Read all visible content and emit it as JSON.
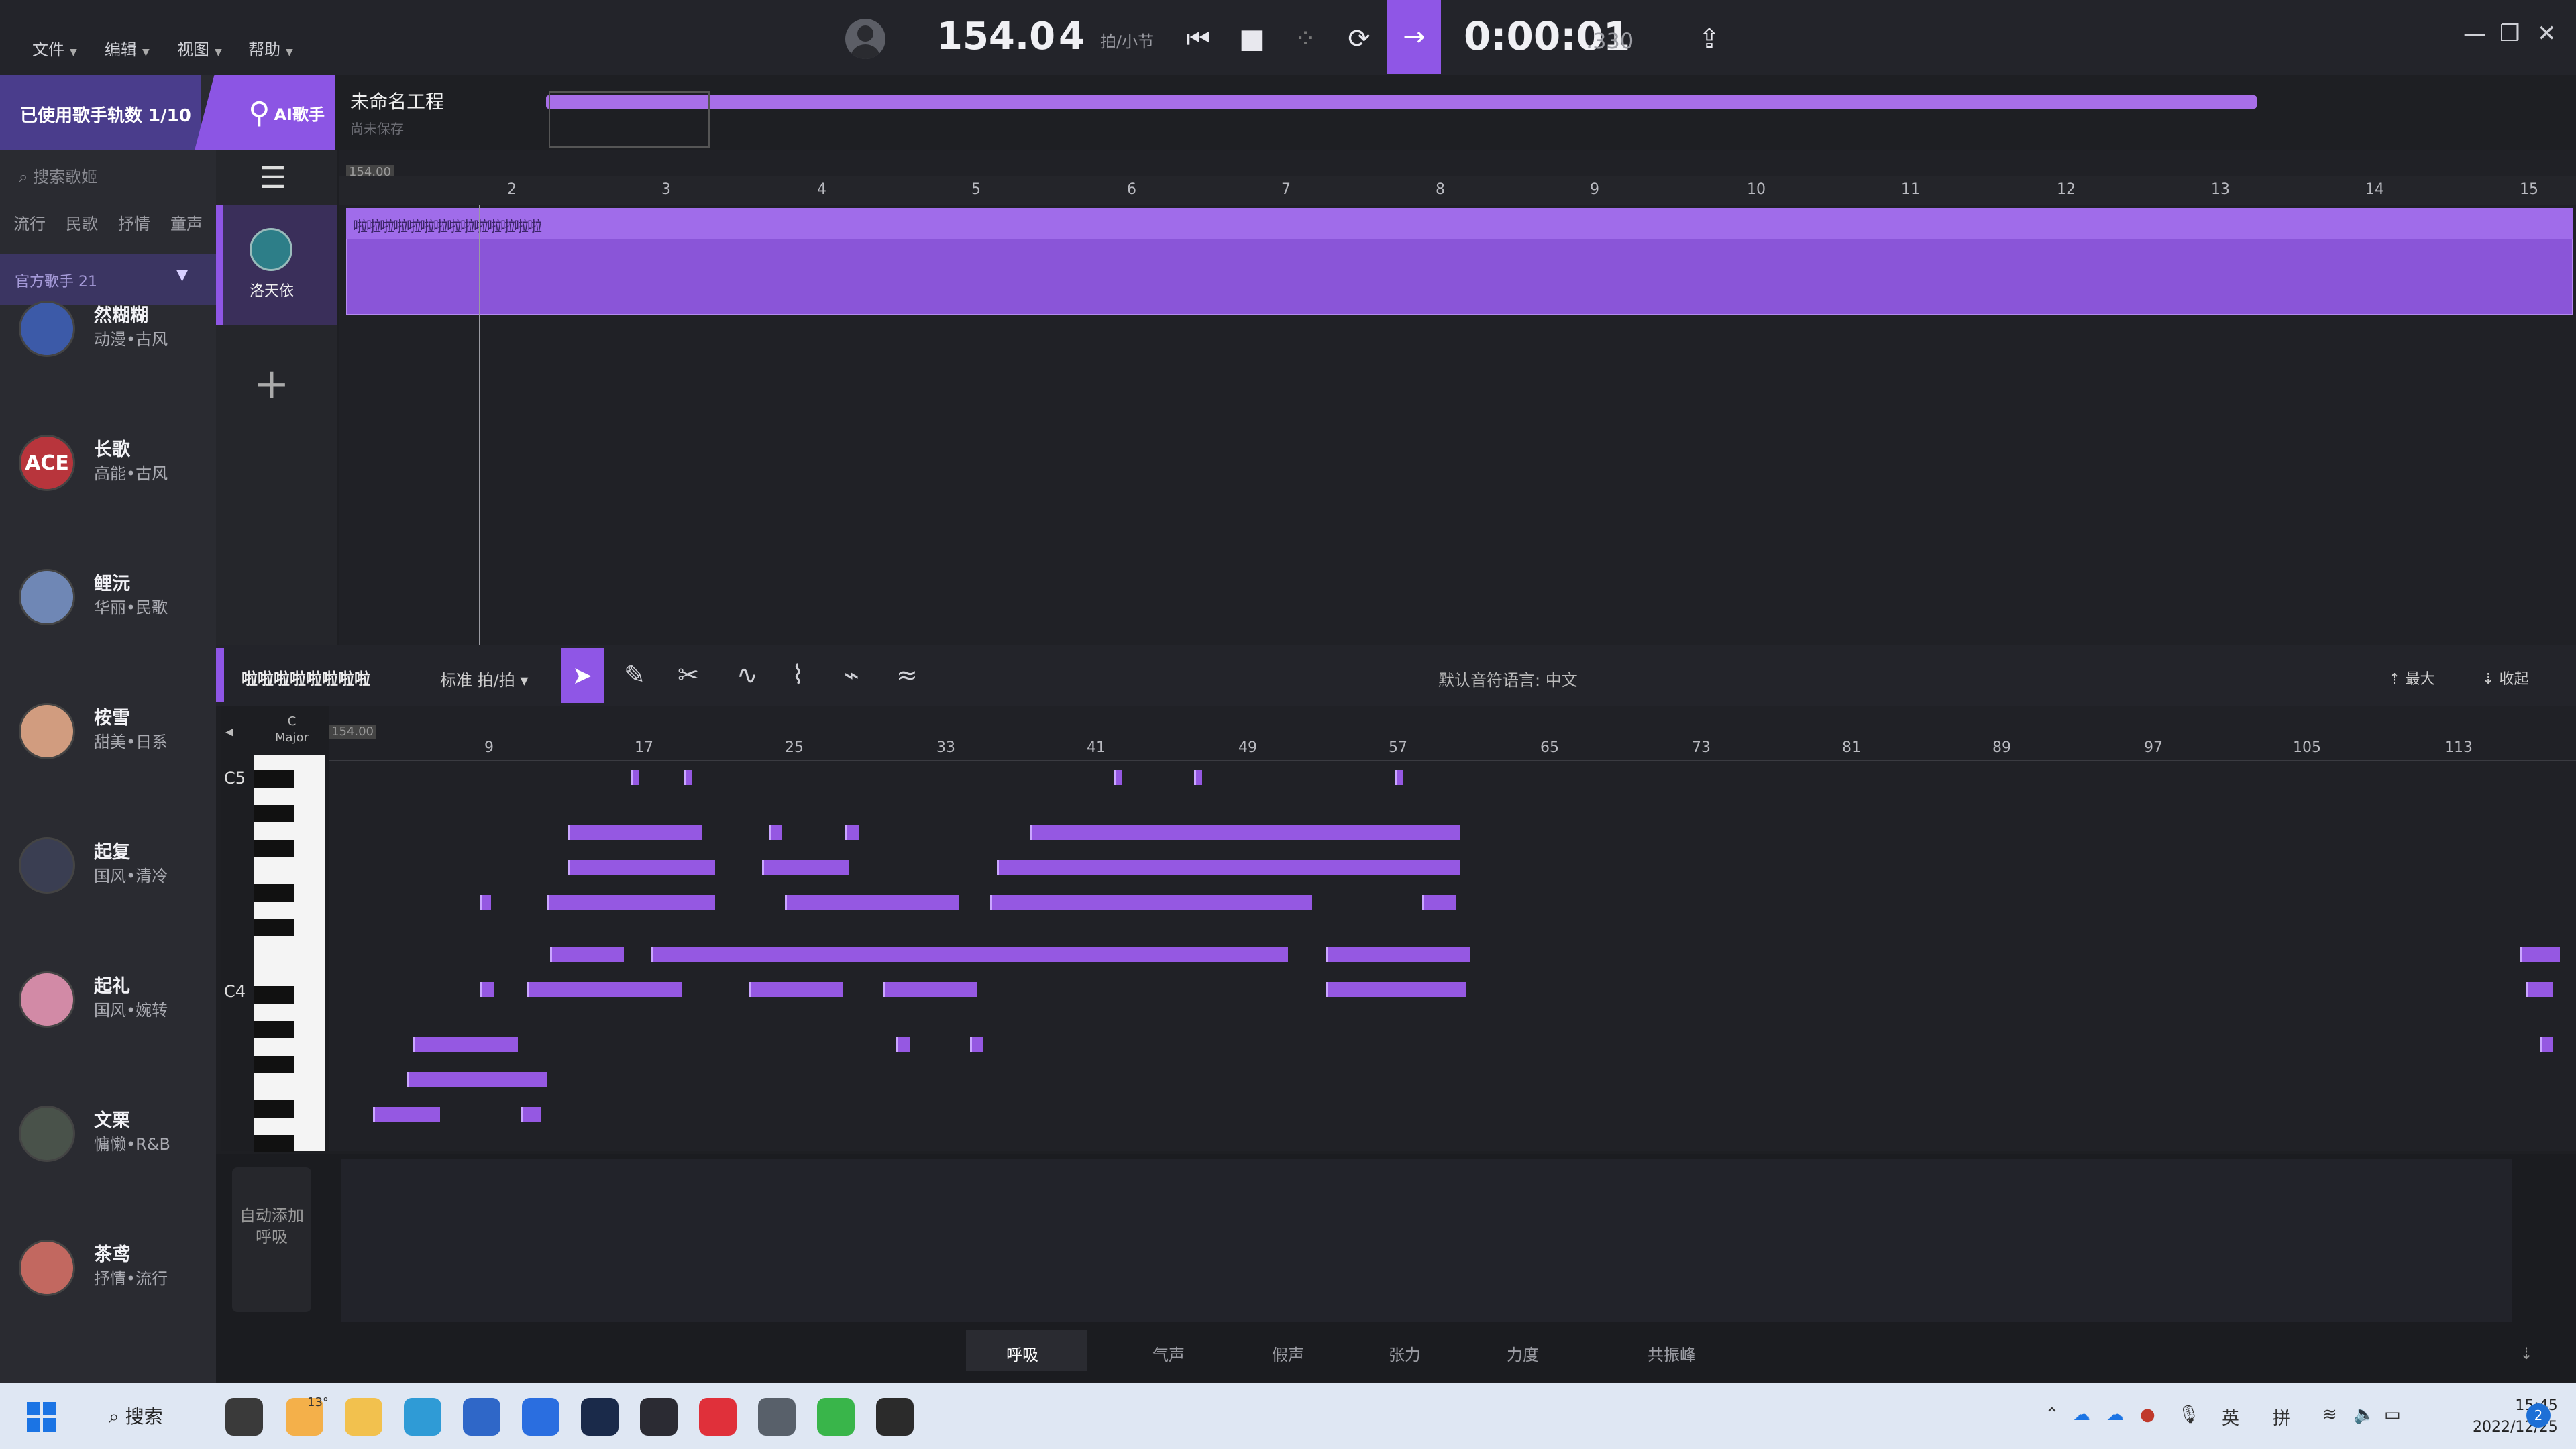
{
  "menu": {
    "file": "文件",
    "edit": "编辑",
    "view": "视图",
    "help": "帮助"
  },
  "transport": {
    "tempo": "154.0",
    "beats": "4",
    "beats_label": "拍/小节",
    "time": "0:00:01",
    "time_ms": ".330"
  },
  "left": {
    "singer_count": "已使用歌手轨数 1/10",
    "ai_tab": "AI歌手",
    "search_placeholder": "搜索歌姬",
    "filters": [
      "流行",
      "民歌",
      "抒情",
      "童声"
    ],
    "official": "官方歌手 21",
    "singers": [
      {
        "name": "然糊糊",
        "style": "动漫•古风",
        "color": "#3c5aa8"
      },
      {
        "name": "长歌",
        "style": "高能•古风",
        "color": "#b8353c"
      },
      {
        "name": "鲤沅",
        "style": "华丽•民歌",
        "color": "#6f87b5"
      },
      {
        "name": "桉雪",
        "style": "甜美•日系",
        "color": "#d19c7f"
      },
      {
        "name": "起复",
        "style": "国风•清冷",
        "color": "#3a3e52"
      },
      {
        "name": "起礼",
        "style": "国风•婉转",
        "color": "#d28aa6"
      },
      {
        "name": "文栗",
        "style": "慵懒•R&B",
        "color": "#49524a"
      },
      {
        "name": "茶鸢",
        "style": "抒情•流行",
        "color": "#c26860"
      }
    ]
  },
  "project": {
    "name": "未命名工程",
    "saved": "尚未保存"
  },
  "track": {
    "singer": "洛天依",
    "tempo_marker": "154.00",
    "lyric": "啦啦啦啦啦啦啦啦啦啦啦啦啦啦"
  },
  "ruler_top": [
    "2",
    "3",
    "4",
    "5",
    "6",
    "7",
    "8",
    "9",
    "10",
    "11",
    "12",
    "13",
    "14",
    "15"
  ],
  "piano_roll": {
    "lyric": "啦啦啦啦啦啦啦啦",
    "mode": "标准 拍/拍",
    "language": "默认音符语言: 中文",
    "maximize": "最大",
    "collapse": "收起",
    "key": "C",
    "scale": "Major",
    "tempo_marker": "154.00",
    "c5": "C5",
    "c4": "C4",
    "ruler": [
      "9",
      "17",
      "25",
      "33",
      "41",
      "49",
      "57",
      "65",
      "73",
      "81",
      "89",
      "97",
      "105",
      "113"
    ]
  },
  "params": {
    "auto_breath": "自动添加呼吸",
    "tabs": [
      "呼吸",
      "气声",
      "假声",
      "张力",
      "力度",
      "共振峰"
    ]
  },
  "taskbar": {
    "search": "搜索",
    "temp": "13°",
    "ime_lang": "英",
    "ime_mode": "拼",
    "time": "15:45",
    "date": "2022/12/25",
    "notifications": "2"
  },
  "colors": {
    "accent": "#8f56e6",
    "note": "#9558e2"
  }
}
